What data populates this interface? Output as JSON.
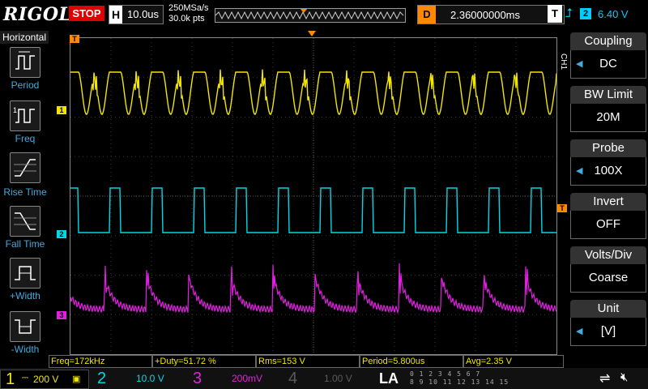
{
  "header": {
    "brand": "RIGOL",
    "run_state": "STOP",
    "timebase_key": "H",
    "timebase": "10.0us",
    "sample_rate": "250MSa/s",
    "memory_depth": "30.0k pts",
    "delay_key": "D",
    "delay": "2.36000000ms",
    "trigger_key": "T",
    "trigger_source": "2",
    "trigger_level": "6.40 V"
  },
  "left_panel": {
    "title": "Horizontal",
    "buttons": [
      {
        "label": "Period",
        "icon": "period-icon"
      },
      {
        "label": "Freq",
        "icon": "freq-icon"
      },
      {
        "label": "Rise Time",
        "icon": "rise-time-icon"
      },
      {
        "label": "Fall Time",
        "icon": "fall-time-icon"
      },
      {
        "label": "+Width",
        "icon": "positive-width-icon"
      },
      {
        "label": "-Width",
        "icon": "negative-width-icon"
      }
    ]
  },
  "channel_menu": {
    "tag": "CH1",
    "items": [
      {
        "title": "Coupling",
        "value": "DC"
      },
      {
        "title": "BW Limit",
        "value": "20M"
      },
      {
        "title": "Probe",
        "value": "100X"
      },
      {
        "title": "Invert",
        "value": "OFF"
      },
      {
        "title": "Volts/Div",
        "value": "Coarse"
      },
      {
        "title": "Unit",
        "value": "[V]"
      }
    ]
  },
  "measurements": [
    {
      "text": "Freq=172kHz"
    },
    {
      "text": "+Duty=51.72 %"
    },
    {
      "text": "Rms=153 V"
    },
    {
      "text": "Period=5.800us"
    },
    {
      "text": "Avg=2.35 V"
    }
  ],
  "channels": [
    {
      "num": "1",
      "scale": "200 V",
      "color": "#f2e600"
    },
    {
      "num": "2",
      "scale": "10.0 V",
      "color": "#00d8e8"
    },
    {
      "num": "3",
      "scale": "200mV",
      "color": "#e020e0"
    },
    {
      "num": "4",
      "scale": "1.00 V",
      "color": "#5a5a5a"
    }
  ],
  "la": {
    "label": "LA",
    "digits_row1": "0 1 2 3  4 5 6 7",
    "digits_row2": "8 9 10 11  12 13 14 15"
  },
  "marker_labels": {
    "trigger_pos": "T",
    "ch1": "1",
    "ch2": "2",
    "ch3": "3",
    "trig_level": "T"
  },
  "colors": {
    "ch1": "#f2e600",
    "ch2": "#00d8e8",
    "ch3": "#e020e0",
    "accent": "#ff8800",
    "grid": "#3a3a3a",
    "stop": "#e00000"
  }
}
